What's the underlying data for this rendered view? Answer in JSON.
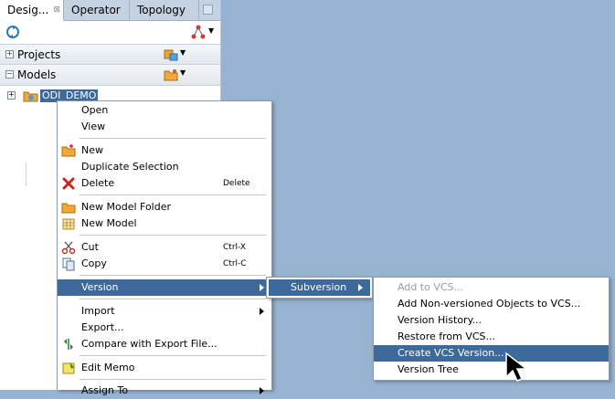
{
  "tabs": [
    {
      "label": "Desig...",
      "active": true
    },
    {
      "label": "Operator",
      "active": false
    },
    {
      "label": "Topology",
      "active": false
    }
  ],
  "sections": {
    "projects": "Projects",
    "models": "Models"
  },
  "tree": {
    "node_label": "ODI_DEMO"
  },
  "context_menu": {
    "open": "Open",
    "view": "View",
    "new": "New",
    "duplicate": "Duplicate Selection",
    "delete": "Delete",
    "delete_shortcut": "Delete",
    "new_model_folder": "New Model Folder",
    "new_model": "New Model",
    "cut": "Cut",
    "cut_shortcut": "Ctrl-X",
    "copy": "Copy",
    "copy_shortcut": "Ctrl-C",
    "version": "Version",
    "import": "Import",
    "export": "Export...",
    "compare": "Compare with Export File...",
    "edit_memo": "Edit Memo",
    "partial": "Assign To"
  },
  "version_menu": {
    "subversion": "Subversion"
  },
  "subversion_menu": {
    "add_to_vcs": "Add to VCS...",
    "add_non_versioned": "Add Non-versioned Objects to VCS...",
    "version_history": "Version History...",
    "restore": "Restore from VCS...",
    "create_version": "Create VCS Version...",
    "version_tree": "Version Tree"
  },
  "colors": {
    "desktop": "#96b3d1",
    "selection": "#3d6a9b",
    "tree_selection": "#3d6a9b"
  }
}
